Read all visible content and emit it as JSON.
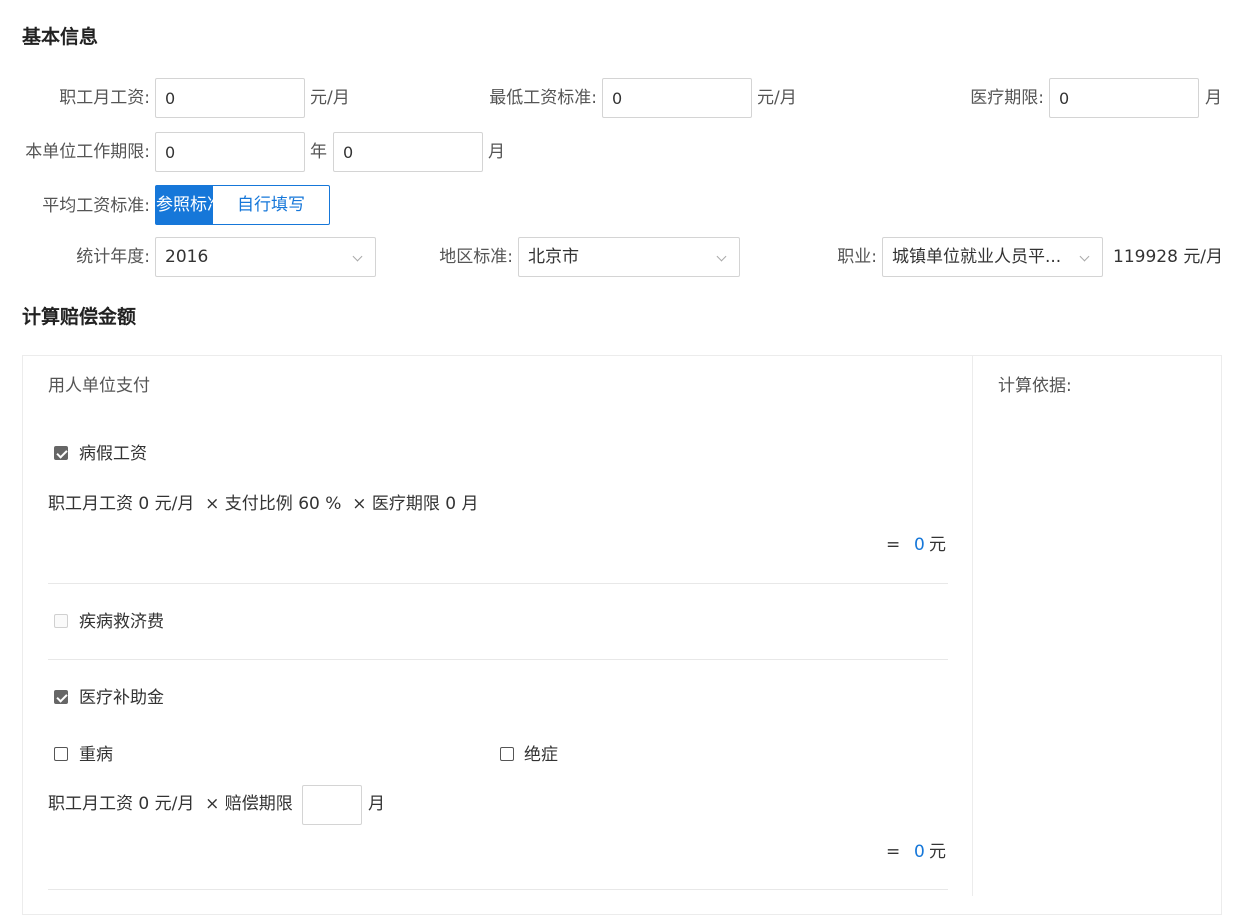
{
  "basic": {
    "title": "基本信息",
    "monthly_wage": {
      "label": "职工月工资:",
      "value": "0",
      "unit": "元/月"
    },
    "min_wage": {
      "label": "最低工资标准:",
      "value": "0",
      "unit": "元/月"
    },
    "medical_period": {
      "label": "医疗期限:",
      "value": "0",
      "unit": "月"
    },
    "work_period": {
      "label": "本单位工作期限:",
      "years_value": "0",
      "years_unit": "年",
      "months_value": "0",
      "months_unit": "月"
    },
    "avg_wage_std": {
      "label": "平均工资标准:",
      "option_reference": "参照标准",
      "option_custom": "自行填写"
    },
    "stat_year": {
      "label": "统计年度:",
      "value": "2016"
    },
    "region": {
      "label": "地区标准:",
      "value": "北京市"
    },
    "occupation": {
      "label": "职业:",
      "value": "城镇单位就业人员平...",
      "amount": "119928",
      "amount_unit": "元/月"
    }
  },
  "calc": {
    "title": "计算赔偿金额",
    "employer_pay": "用人单位支付",
    "basis_label": "计算依据:",
    "sick_pay": {
      "label": "病假工资",
      "formula": "职工月工资 0 元/月  × 支付比例 60 %  × 医疗期限 0 月",
      "equals": "=",
      "result": "0",
      "result_unit": "元"
    },
    "sickness_relief": {
      "label": "疾病救济费"
    },
    "medical_subsidy": {
      "label": "医疗补助金",
      "serious_illness": "重病",
      "terminal_illness": "绝症",
      "formula_prefix": "职工月工资 0 元/月  × 赔偿期限",
      "formula_unit": "月",
      "period_value": "",
      "equals": "=",
      "result": "0",
      "result_unit": "元"
    }
  }
}
